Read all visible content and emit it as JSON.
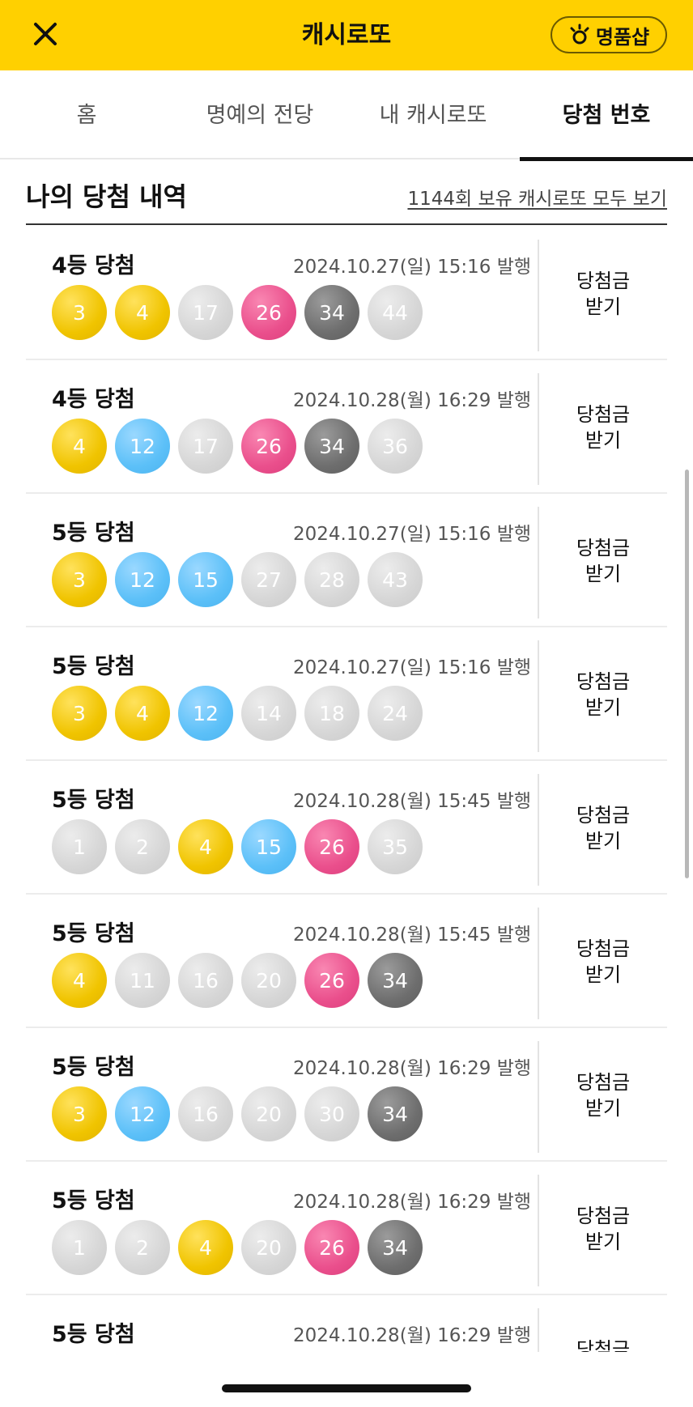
{
  "header": {
    "title": "캐시로또",
    "shop_label": "명품샵",
    "close_icon": "close-icon",
    "shop_icon": "sun-icon",
    "bg_color": "#FFD000"
  },
  "tabs": [
    {
      "label": "홈",
      "active": false
    },
    {
      "label": "명예의 전당",
      "active": false
    },
    {
      "label": "내 캐시로또",
      "active": false
    },
    {
      "label": "당첨 번호",
      "active": true
    }
  ],
  "section": {
    "title": "나의 당첨 내역",
    "view_all": "1144회 보유 캐시로또 모두 보기"
  },
  "ball_colors": {
    "yellow": "#F0C400",
    "blue": "#5CC0F8",
    "pink": "#EA4F8C",
    "dark": "#6E6E6E",
    "gray": "#D6D6D6"
  },
  "claim_label": "당첨금\n받기",
  "wins": [
    {
      "rank": "4등 당첨",
      "date": "2024.10.27(일) 15:16 발행",
      "balls": [
        {
          "n": "3",
          "c": "yellow"
        },
        {
          "n": "4",
          "c": "yellow"
        },
        {
          "n": "17",
          "c": "gray"
        },
        {
          "n": "26",
          "c": "pink"
        },
        {
          "n": "34",
          "c": "dark"
        },
        {
          "n": "44",
          "c": "gray"
        }
      ]
    },
    {
      "rank": "4등 당첨",
      "date": "2024.10.28(월) 16:29 발행",
      "balls": [
        {
          "n": "4",
          "c": "yellow"
        },
        {
          "n": "12",
          "c": "blue"
        },
        {
          "n": "17",
          "c": "gray"
        },
        {
          "n": "26",
          "c": "pink"
        },
        {
          "n": "34",
          "c": "dark"
        },
        {
          "n": "36",
          "c": "gray"
        }
      ]
    },
    {
      "rank": "5등 당첨",
      "date": "2024.10.27(일) 15:16 발행",
      "balls": [
        {
          "n": "3",
          "c": "yellow"
        },
        {
          "n": "12",
          "c": "blue"
        },
        {
          "n": "15",
          "c": "blue"
        },
        {
          "n": "27",
          "c": "gray"
        },
        {
          "n": "28",
          "c": "gray"
        },
        {
          "n": "43",
          "c": "gray"
        }
      ]
    },
    {
      "rank": "5등 당첨",
      "date": "2024.10.27(일) 15:16 발행",
      "balls": [
        {
          "n": "3",
          "c": "yellow"
        },
        {
          "n": "4",
          "c": "yellow"
        },
        {
          "n": "12",
          "c": "blue"
        },
        {
          "n": "14",
          "c": "gray"
        },
        {
          "n": "18",
          "c": "gray"
        },
        {
          "n": "24",
          "c": "gray"
        }
      ]
    },
    {
      "rank": "5등 당첨",
      "date": "2024.10.28(월) 15:45 발행",
      "balls": [
        {
          "n": "1",
          "c": "gray"
        },
        {
          "n": "2",
          "c": "gray"
        },
        {
          "n": "4",
          "c": "yellow"
        },
        {
          "n": "15",
          "c": "blue"
        },
        {
          "n": "26",
          "c": "pink"
        },
        {
          "n": "35",
          "c": "gray"
        }
      ]
    },
    {
      "rank": "5등 당첨",
      "date": "2024.10.28(월) 15:45 발행",
      "balls": [
        {
          "n": "4",
          "c": "yellow"
        },
        {
          "n": "11",
          "c": "gray"
        },
        {
          "n": "16",
          "c": "gray"
        },
        {
          "n": "20",
          "c": "gray"
        },
        {
          "n": "26",
          "c": "pink"
        },
        {
          "n": "34",
          "c": "dark"
        }
      ]
    },
    {
      "rank": "5등 당첨",
      "date": "2024.10.28(월) 16:29 발행",
      "balls": [
        {
          "n": "3",
          "c": "yellow"
        },
        {
          "n": "12",
          "c": "blue"
        },
        {
          "n": "16",
          "c": "gray"
        },
        {
          "n": "20",
          "c": "gray"
        },
        {
          "n": "30",
          "c": "gray"
        },
        {
          "n": "34",
          "c": "dark"
        }
      ]
    },
    {
      "rank": "5등 당첨",
      "date": "2024.10.28(월) 16:29 발행",
      "balls": [
        {
          "n": "1",
          "c": "gray"
        },
        {
          "n": "2",
          "c": "gray"
        },
        {
          "n": "4",
          "c": "yellow"
        },
        {
          "n": "20",
          "c": "gray"
        },
        {
          "n": "26",
          "c": "pink"
        },
        {
          "n": "34",
          "c": "dark"
        }
      ]
    },
    {
      "rank": "5등 당첨",
      "date": "2024.10.28(월) 16:29 발행",
      "balls": []
    }
  ]
}
